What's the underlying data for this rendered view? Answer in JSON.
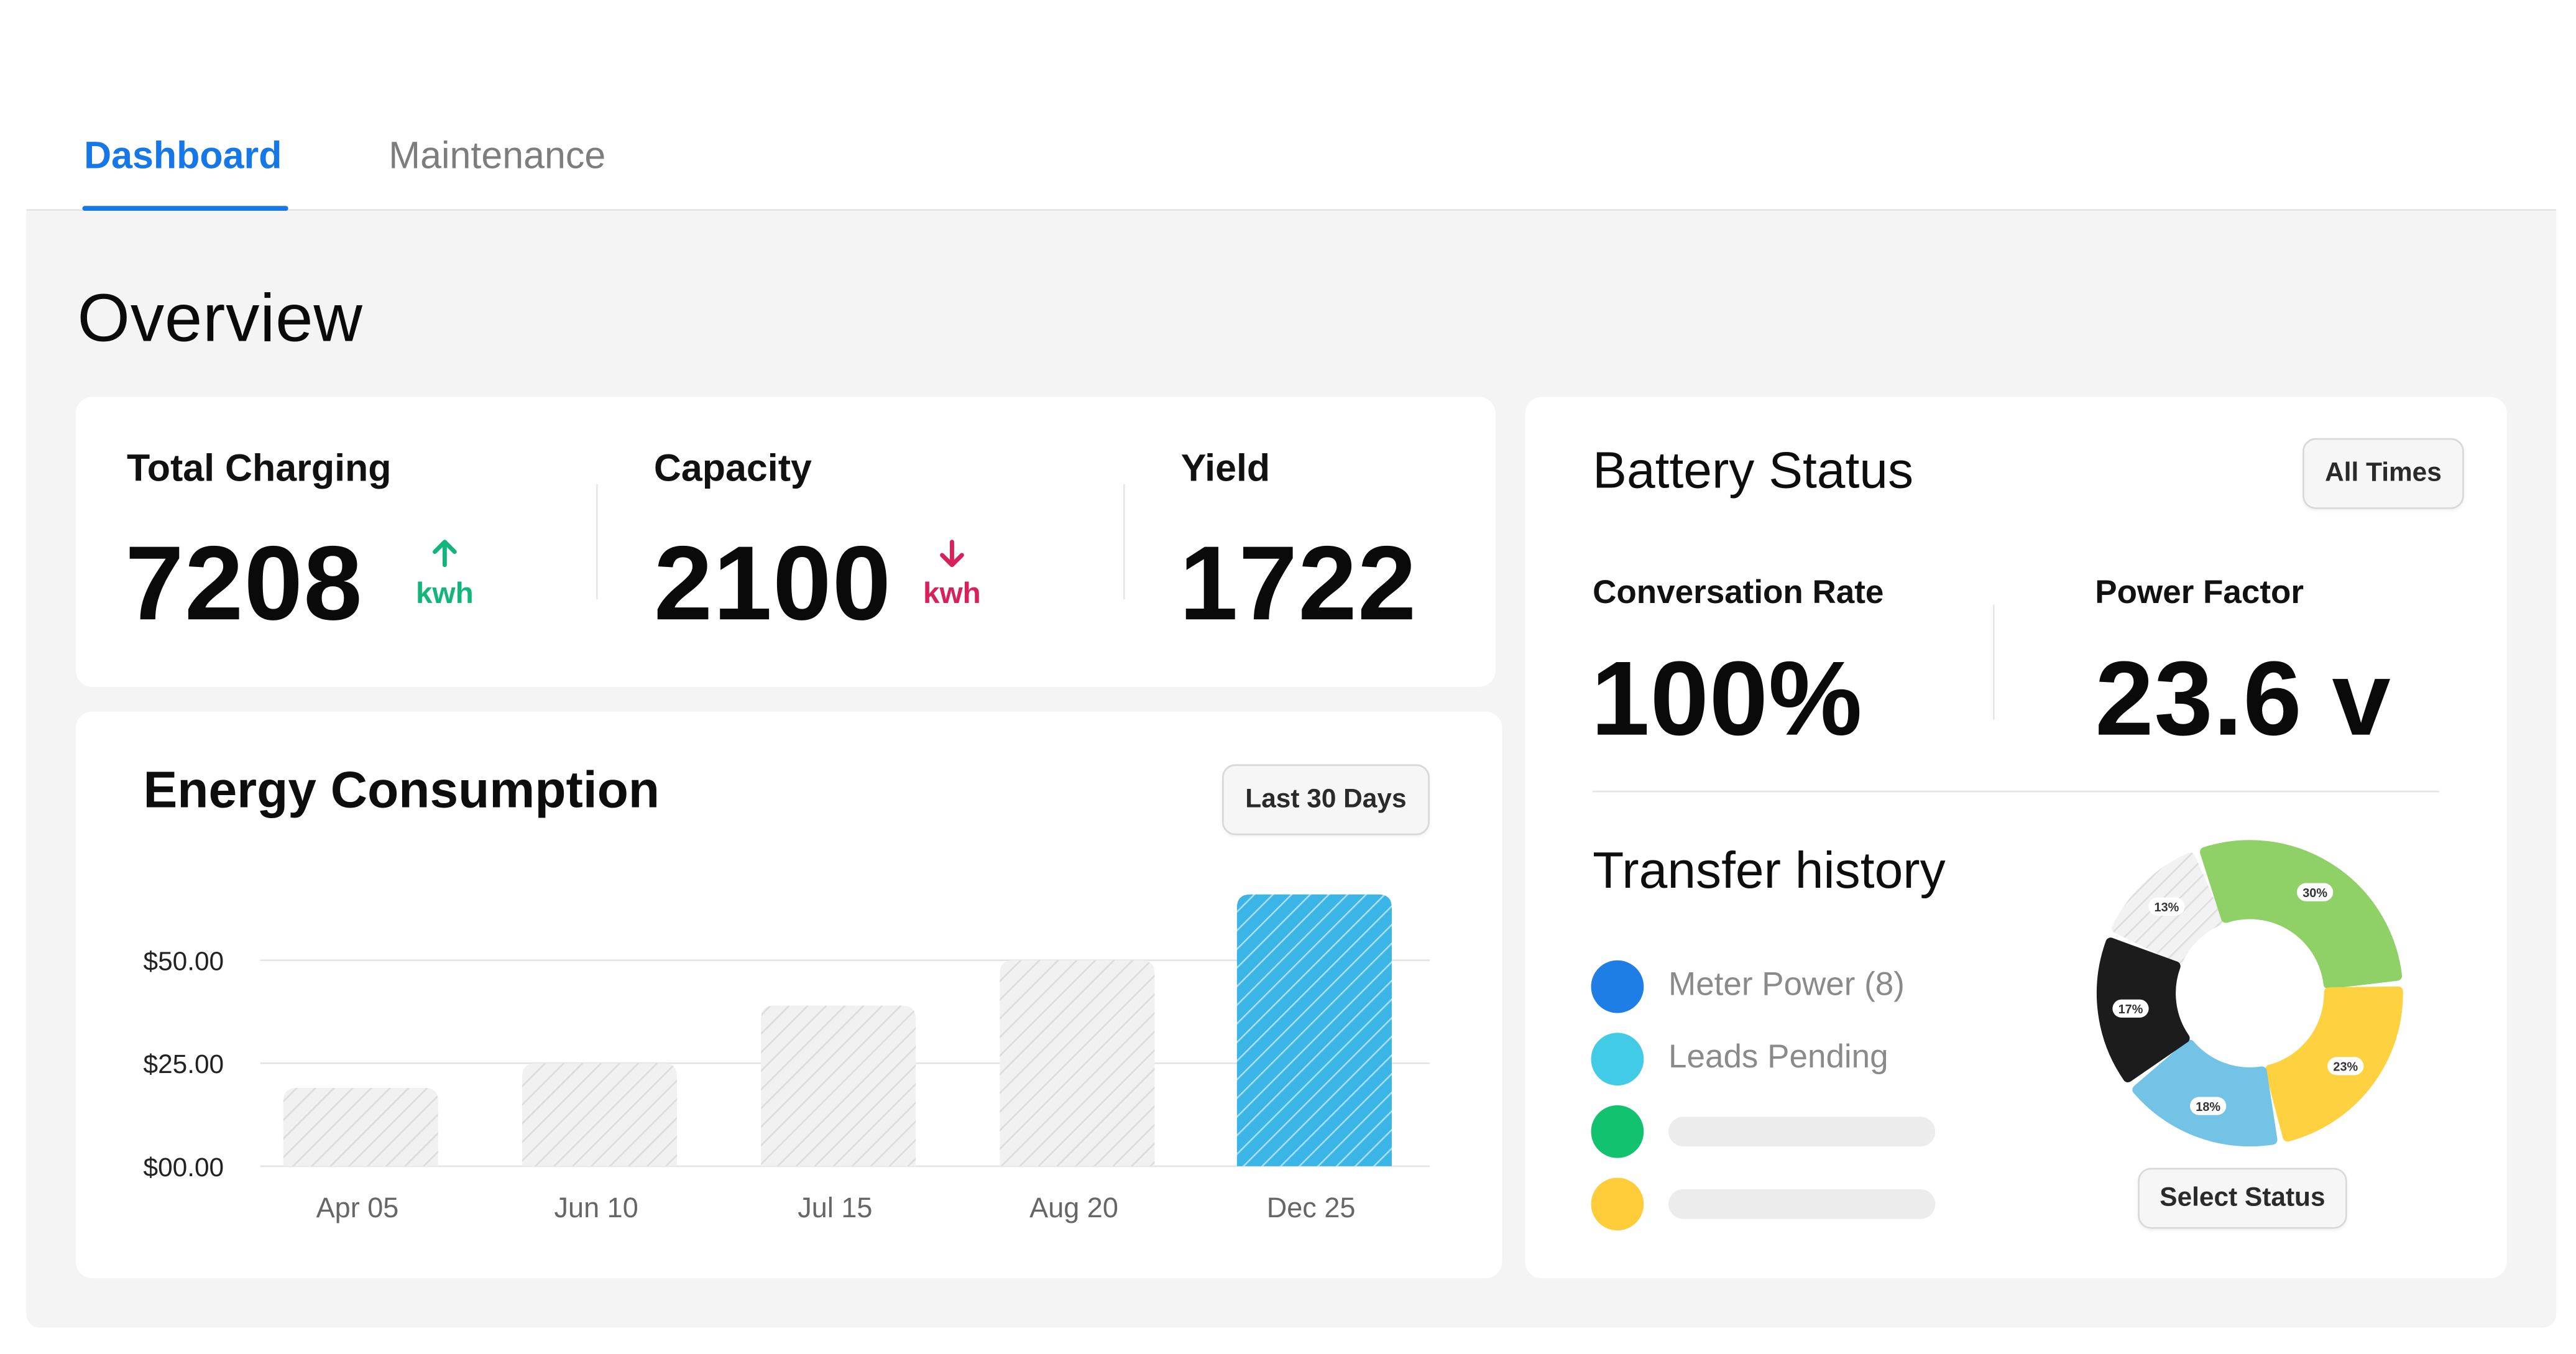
{
  "tabs": [
    {
      "label": "Dashboard",
      "active": true
    },
    {
      "label": "Maintenance",
      "active": false
    }
  ],
  "page_title": "Overview",
  "stats": [
    {
      "label": "Total Charging",
      "value": "7208",
      "unit": "kwh",
      "trend": "up"
    },
    {
      "label": "Capacity",
      "value": "2100",
      "unit": "kwh",
      "trend": "down"
    },
    {
      "label": "Yield",
      "value": "1722"
    }
  ],
  "energy": {
    "title": "Energy Consumption",
    "filter_label": "Last 30 Days"
  },
  "battery": {
    "title": "Battery Status",
    "filter_label": "All Times",
    "conversation_rate_label": "Conversation Rate",
    "conversation_rate_value": "100%",
    "power_factor_label": "Power Factor",
    "power_factor_value": "23.6 v"
  },
  "transfer_history": {
    "title": "Transfer history",
    "legend": [
      {
        "label": "Meter Power (8)",
        "color": "#1e7ee6"
      },
      {
        "label": "Leads Pending",
        "color": "#41cbe6"
      },
      {
        "label": "",
        "color": "#13c26e"
      },
      {
        "label": "",
        "color": "#ffcc3a"
      }
    ],
    "select_label": "Select Status"
  },
  "colors": {
    "accent": "#1677e8",
    "trend_up": "#12b57a",
    "trend_down": "#d8205a",
    "bar_highlight": "#3db8e8",
    "bar_muted": "#e9e9e9"
  },
  "icons": {
    "trend_up": "arrow-up-icon",
    "trend_down": "arrow-down-icon"
  },
  "chart_data": [
    {
      "type": "bar",
      "categories": [
        "Apr 05",
        "Jun 10",
        "Jul 15",
        "Aug 20",
        "Dec 25"
      ],
      "values": [
        19,
        25,
        39,
        50,
        66
      ],
      "highlight_index": 4,
      "y_ticks": [
        0,
        25,
        50
      ],
      "y_tick_labels": [
        "$00.00",
        "$25.00",
        "$50.00"
      ],
      "ylim": [
        0,
        66
      ],
      "grid": true,
      "xlabel": "",
      "ylabel": ""
    },
    {
      "type": "pie",
      "variant": "donut",
      "labels": [
        "13%",
        "30%",
        "23%",
        "18%",
        "17%"
      ],
      "values": [
        13,
        30,
        23,
        18,
        17
      ],
      "colors": [
        "#eeeeee",
        "#8fd067",
        "#fdd13f",
        "#72c3e6",
        "#1c1c1c"
      ]
    }
  ]
}
